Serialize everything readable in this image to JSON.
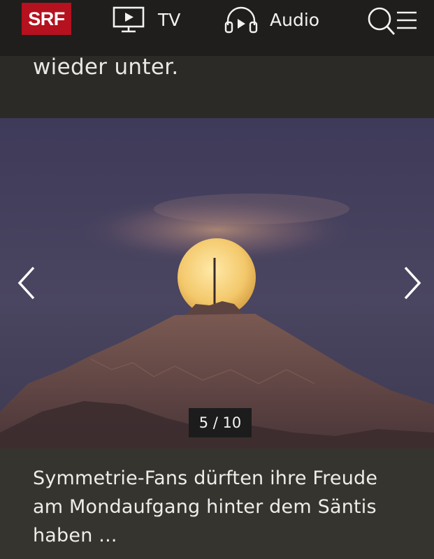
{
  "header": {
    "logo_text": "SRF",
    "nav": [
      {
        "label": "TV",
        "icon": "tv-icon"
      },
      {
        "label": "Audio",
        "icon": "headphones-icon"
      }
    ],
    "search_icon": "search-menu-icon"
  },
  "teaser": {
    "text": "wieder unter."
  },
  "gallery": {
    "counter": "5 / 10",
    "prev_icon": "chevron-left-icon",
    "next_icon": "chevron-right-icon",
    "caption": "Symmetrie-Fans dürften ihre Freude am Mondaufgang hinter dem Säntis haben ..."
  },
  "colors": {
    "brand": "#b5111e",
    "header_bg": "#1f1e1c",
    "caption_bg": "#35342f"
  }
}
